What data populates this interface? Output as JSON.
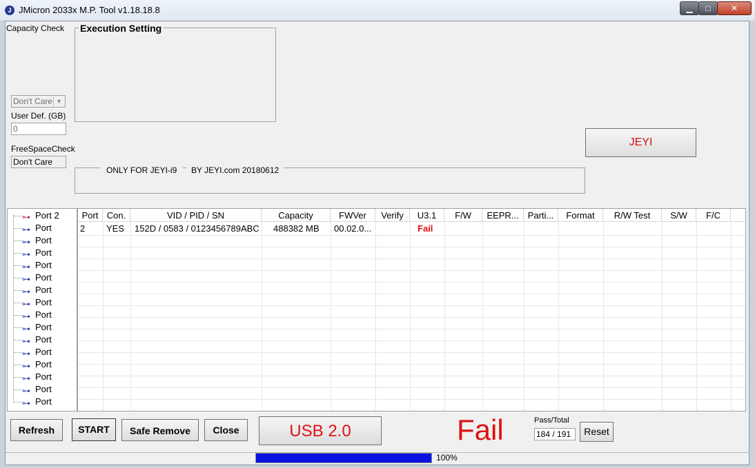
{
  "window": {
    "title": "JMicron 2033x M.P. Tool v1.18.18.8",
    "min": "▁",
    "max": "□",
    "close": "✕",
    "icon": "J"
  },
  "left_panel": {
    "capacity_check_label": "Capacity Check",
    "capacity_select": "Don't Care",
    "user_def_label": "User Def. (GB)",
    "user_def_value": "0",
    "free_space_label": "FreeSpaceCheck",
    "free_space_value": "Don't Care"
  },
  "execution_setting": {
    "title": "Execution Setting"
  },
  "jeyi_button": "JEYI",
  "info_box": {
    "left": "ONLY FOR JEYI-i9",
    "right": "BY JEYI.com  20180612"
  },
  "ports": [
    "Port 2",
    "Port",
    "Port",
    "Port",
    "Port",
    "Port",
    "Port",
    "Port",
    "Port",
    "Port",
    "Port",
    "Port",
    "Port",
    "Port",
    "Port",
    "Port"
  ],
  "table": {
    "columns": [
      "Port",
      "Con.",
      "VID / PID / SN",
      "Capacity",
      "FWVer",
      "Verify",
      "U3.1",
      "F/W",
      "EEPR...",
      "Parti...",
      "Format",
      "R/W Test",
      "S/W",
      "F/C"
    ],
    "rows": [
      {
        "port": "2",
        "con": "YES",
        "vid": "152D / 0583 / 0123456789ABC",
        "capacity": "488382 MB",
        "fwver": "00.02.0...",
        "u31": "Fail"
      }
    ]
  },
  "bottom": {
    "refresh": "Refresh",
    "start": "START",
    "safe_remove": "Safe Remove",
    "close": "Close",
    "usb_mode": "USB 2.0",
    "result": "Fail",
    "pass_total_label": "Pass/Total",
    "pass_total_value": "184 / 191",
    "reset": "Reset"
  },
  "progress": {
    "value": 1.0,
    "label": "100%"
  },
  "colors": {
    "fail_red": "#e01010",
    "progress_blue": "#0a12e0",
    "usb_icon": "#2c3fa8"
  }
}
